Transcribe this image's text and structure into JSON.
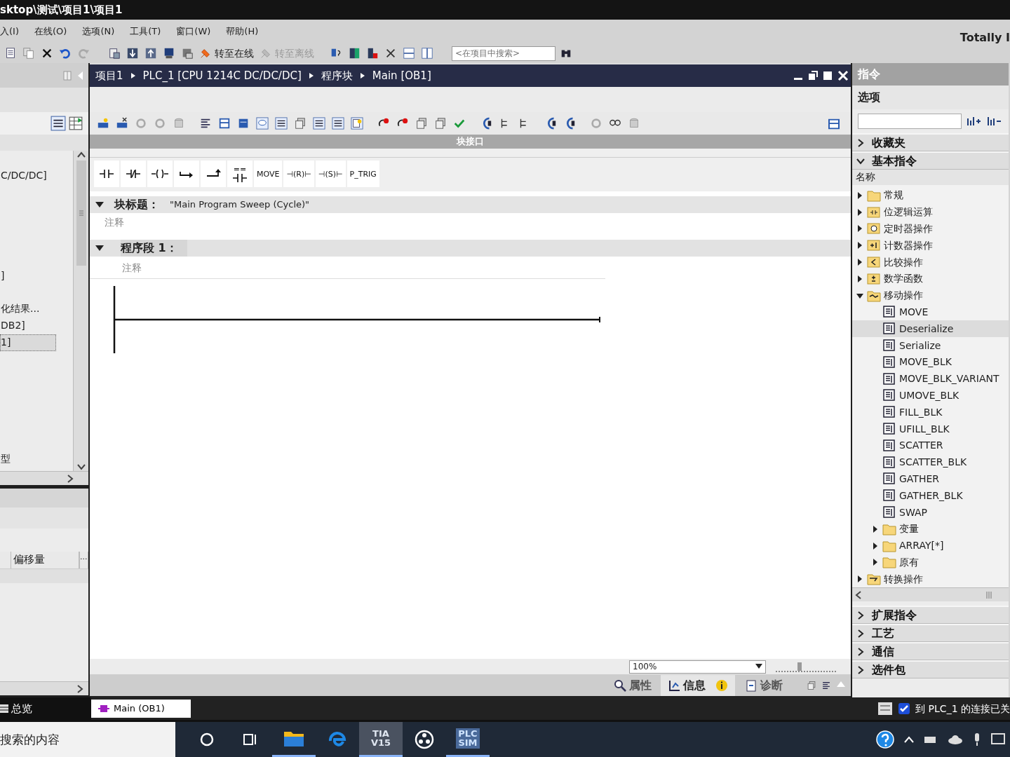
{
  "window": {
    "title": "sktop\\测试\\项目1\\项目1",
    "product": "Totally I"
  },
  "menu": [
    "入(I)",
    "在线(O)",
    "选项(N)",
    "工具(T)",
    "窗口(W)",
    "帮助(H)"
  ],
  "toolbar": {
    "buttons": [
      {
        "label": "转至在线",
        "disabled": false
      },
      {
        "label": "转至离线",
        "disabled": true
      }
    ],
    "search": {
      "placeholder": "<在项目中搜索>"
    }
  },
  "project_tree": {
    "rows": [
      {
        "text": "C/DC/DC]",
        "selected": false
      },
      {
        "text": "]",
        "selected": false
      },
      {
        "text": "化结果...",
        "selected": false
      },
      {
        "text": "DB2]",
        "selected": false
      },
      {
        "text": "1]",
        "selected": true
      },
      {
        "text": "型",
        "selected": false
      }
    ]
  },
  "details": {
    "columns": [
      "偏移量",
      "..."
    ]
  },
  "editor": {
    "breadcrumb": [
      "项目1",
      "PLC_1 [CPU 1214C DC/DC/DC]",
      "程序块",
      "Main [OB1]"
    ],
    "interface_bar": "块接口",
    "favorites": [
      {
        "kind": "contact"
      },
      {
        "kind": "nc_contact"
      },
      {
        "kind": "coil"
      },
      {
        "kind": "branch_open"
      },
      {
        "kind": "branch_close"
      },
      {
        "kind": "compare",
        "label": "=="
      },
      {
        "kind": "text",
        "label": "MOVE"
      },
      {
        "kind": "text",
        "label": "⊣(R)⊢"
      },
      {
        "kind": "text",
        "label": "⊣(S)⊢"
      },
      {
        "kind": "text",
        "label": "P_TRIG"
      }
    ],
    "block_title": {
      "label": "块标题：",
      "value": "\"Main Program Sweep (Cycle)\"",
      "expanded": true,
      "comment": "注释"
    },
    "networks": [
      {
        "label": "程序段 1：",
        "expanded": true,
        "comment": "注释"
      }
    ],
    "zoom": {
      "value": "100%",
      "level": 0.39
    },
    "inspector_tabs": [
      {
        "label": "属性",
        "selected": false,
        "kind": "properties"
      },
      {
        "label": "信息",
        "selected": true,
        "kind": "info"
      },
      {
        "label": "诊断",
        "selected": false,
        "kind": "diagnostics"
      }
    ]
  },
  "instructions": {
    "title": "指令",
    "options": "选项",
    "sections_top": [
      {
        "label": "收藏夹",
        "expanded": false
      },
      {
        "label": "基本指令",
        "expanded": true
      }
    ],
    "column": "名称",
    "tree": [
      {
        "label": "常规",
        "kind": "folder",
        "expanded": false,
        "selected": false
      },
      {
        "label": "位逻辑运算",
        "kind": "bitlogic",
        "expanded": false,
        "selected": false
      },
      {
        "label": "定时器操作",
        "kind": "timer",
        "expanded": false,
        "selected": false
      },
      {
        "label": "计数器操作",
        "kind": "counter",
        "expanded": false,
        "selected": false
      },
      {
        "label": "比较操作",
        "kind": "compare",
        "expanded": false,
        "selected": false
      },
      {
        "label": "数学函数",
        "kind": "math",
        "expanded": false,
        "selected": false
      },
      {
        "label": "移动操作",
        "kind": "move",
        "expanded": true,
        "selected": false,
        "children": [
          {
            "label": "MOVE",
            "kind": "instruction",
            "selected": false
          },
          {
            "label": "Deserialize",
            "kind": "instruction",
            "selected": true
          },
          {
            "label": "Serialize",
            "kind": "instruction",
            "selected": false
          },
          {
            "label": "MOVE_BLK",
            "kind": "instruction",
            "selected": false
          },
          {
            "label": "MOVE_BLK_VARIANT",
            "kind": "instruction",
            "selected": false
          },
          {
            "label": "UMOVE_BLK",
            "kind": "instruction",
            "selected": false
          },
          {
            "label": "FILL_BLK",
            "kind": "instruction",
            "selected": false
          },
          {
            "label": "UFILL_BLK",
            "kind": "instruction",
            "selected": false
          },
          {
            "label": "SCATTER",
            "kind": "instruction",
            "selected": false
          },
          {
            "label": "SCATTER_BLK",
            "kind": "instruction",
            "selected": false
          },
          {
            "label": "GATHER",
            "kind": "instruction",
            "selected": false
          },
          {
            "label": "GATHER_BLK",
            "kind": "instruction",
            "selected": false
          },
          {
            "label": "SWAP",
            "kind": "instruction",
            "selected": false
          },
          {
            "label": "变量",
            "kind": "folder",
            "expanded": false,
            "selected": false
          },
          {
            "label": "ARRAY[*]",
            "kind": "folder",
            "expanded": false,
            "selected": false
          },
          {
            "label": "原有",
            "kind": "folder",
            "expanded": false,
            "selected": false
          }
        ]
      },
      {
        "label": "转换操作",
        "kind": "convert",
        "expanded": false,
        "selected": false
      }
    ],
    "sections_bottom": [
      {
        "label": "扩展指令",
        "expanded": false
      },
      {
        "label": "工艺",
        "expanded": false
      },
      {
        "label": "通信",
        "expanded": false
      },
      {
        "label": "选件包",
        "expanded": false
      }
    ]
  },
  "status_bar": {
    "overview": "总览",
    "tabs": [
      {
        "label": "Main (OB1)",
        "selected": true
      }
    ],
    "message": "到 PLC_1 的连接已关"
  },
  "taskbar": {
    "search": "搜索的内容",
    "apps": [
      {
        "kind": "cortana",
        "running": false,
        "active": false
      },
      {
        "kind": "taskview",
        "running": false,
        "active": false
      },
      {
        "kind": "explorer",
        "running": true,
        "active": false
      },
      {
        "kind": "edge",
        "running": false,
        "active": false
      },
      {
        "kind": "tia",
        "lines": [
          "TIA",
          "V15"
        ],
        "running": true,
        "active": true
      },
      {
        "kind": "obs",
        "running": false,
        "active": false
      },
      {
        "kind": "plcsim",
        "lines": [
          "PLC",
          "SIM"
        ],
        "running": true,
        "active": false
      }
    ]
  }
}
